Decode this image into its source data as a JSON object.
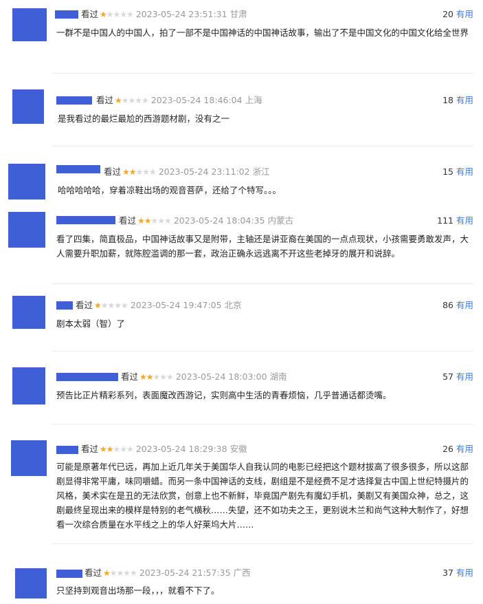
{
  "colors": {
    "accent": "#3a7bd5",
    "star": "#f5a623",
    "redaction": "#3f5fd6"
  },
  "reviews": [
    {
      "watched": "看过",
      "rating": 1,
      "date": "2023-05-24 23:51:31",
      "location": "甘肃",
      "votes": "20",
      "useful_label": "有用",
      "comment": "一群不是中国人的中国人，拍了一部不是中国神话的中国神话故事，输出了不是中国文化的中国文化给全世界"
    },
    {
      "watched": "看过",
      "rating": 1,
      "date": "2023-05-24 18:46:04",
      "location": "上海",
      "votes": "18",
      "useful_label": "有用",
      "comment": "是我看过的最烂最尬的西游题材剧，没有之一"
    },
    {
      "watched": "看过",
      "rating": 2,
      "date": "2023-05-24 23:11:02",
      "location": "浙江",
      "votes": "15",
      "useful_label": "有用",
      "comment": "哈哈哈哈哈，穿着凉鞋出场的观音菩萨，还给了个特写。。。"
    },
    {
      "watched": "看过",
      "rating": 2,
      "date": "2023-05-24 18:04:35",
      "location": "内蒙古",
      "votes": "111",
      "useful_label": "有用",
      "comment": "看了四集，简直极品，中国神话故事又是附带，主轴还是讲亚裔在美国的一点点现状，小孩需要勇敢发声，大人需要升职加薪，就陈腔滥调的那一套，政治正确永远逃离不开这些老掉牙的展开和说辞。"
    },
    {
      "watched": "看过",
      "rating": 1,
      "date": "2023-05-24 19:47:05",
      "location": "北京",
      "votes": "86",
      "useful_label": "有用",
      "comment": "剧本太弱（智）了"
    },
    {
      "watched": "看过",
      "rating": 2,
      "date": "2023-05-24 18:03:00",
      "location": "湖南",
      "votes": "57",
      "useful_label": "有用",
      "comment": "预告比正片精彩系列，表面魔改西游记，实则高中生活的青春烦恼，几乎普通话都烫嘴。"
    },
    {
      "watched": "看过",
      "rating": 2,
      "date": "2023-05-24 18:29:38",
      "location": "安徽",
      "votes": "26",
      "useful_label": "有用",
      "comment": "可能是原著年代已远，再加上近几年关于美国华人自我认同的电影已经把这个题材拔高了很多很多，所以这部剧显得非常平庸，味同嚼蜡。而另一条中国神话的支线，剧组是不是经费不足才选择复古中国上世纪特摄片的风格，美术实在是丑的无法欣赏，创意上也不新鲜，毕竟国产剧先有魔幻手机，美剧又有美国众神，总之，这剧最终呈现出来的模样是特别的老气横秋……失望，还不如功夫之王，更别说木兰和尚气这种大制作了，好想看一次综合质量在水平线之上的华人好莱坞大片……"
    },
    {
      "watched": "看过",
      "rating": 1,
      "date": "2023-05-24 21:57:35",
      "location": "广西",
      "votes": "37",
      "useful_label": "有用",
      "comment": "只坚持到观音出场那一段，，，就看不下了。"
    }
  ]
}
